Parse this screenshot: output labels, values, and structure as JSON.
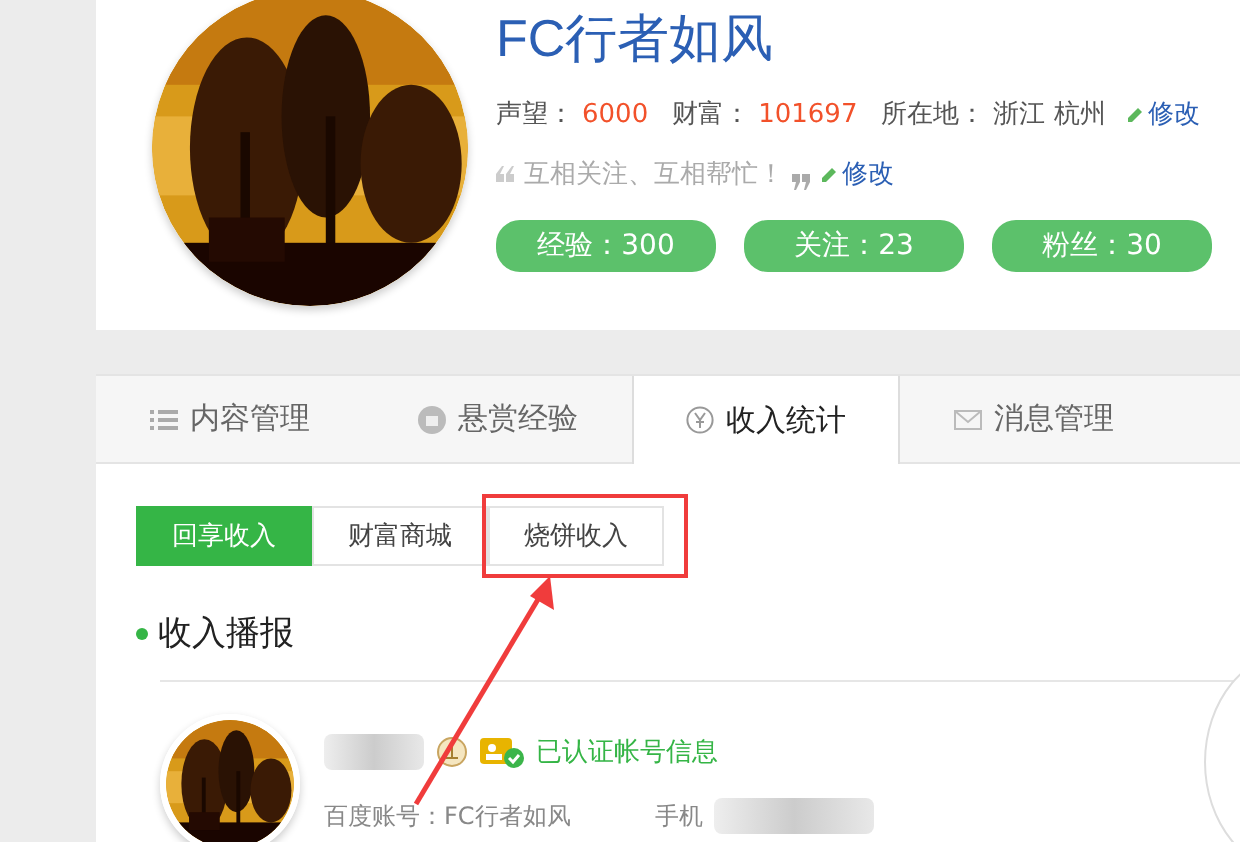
{
  "profile": {
    "name": "FC行者如风",
    "stats": [
      {
        "label": "声望：",
        "value": "6000"
      },
      {
        "label": "财富：",
        "value": "101697"
      }
    ],
    "location_label": "所在地：",
    "location": "浙江 杭州",
    "edit_link": "修改",
    "motto": "互相关注、互相帮忙！",
    "motto_edit": "修改",
    "pills": [
      "经验：300",
      "关注：23",
      "粉丝：30"
    ]
  },
  "tabs": [
    {
      "label": "内容管理",
      "selected": false
    },
    {
      "label": "悬赏经验",
      "selected": false
    },
    {
      "label": "收入统计",
      "selected": true
    },
    {
      "label": "消息管理",
      "selected": false
    }
  ],
  "sub_tabs": [
    {
      "label": "回享收入",
      "selected": true,
      "highlighted": false
    },
    {
      "label": "财富商城",
      "selected": false,
      "highlighted": false
    },
    {
      "label": "烧饼收入",
      "selected": false,
      "highlighted": true
    }
  ],
  "section_title": "收入播报",
  "account": {
    "verified": "已认证帐号信息",
    "baidu_account": "百度账号：FC行者如风",
    "phone_label": "手机"
  }
}
